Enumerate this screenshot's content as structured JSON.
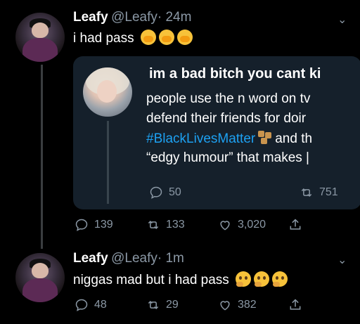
{
  "tweet1": {
    "name": "Leafy",
    "handle": "@Leafy",
    "time": "· 24m",
    "text": "i had pass",
    "emojis": [
      "face-with-hand-over-mouth",
      "face-with-hand-over-mouth",
      "face-with-hand-over-mouth"
    ],
    "stats": {
      "replies": "139",
      "retweets": "133",
      "likes": "3,020"
    }
  },
  "quoted": {
    "title": "im a bad bitch you cant ki",
    "line1": "people use the n word on tv",
    "line2": "defend their friends for doir",
    "hashtag": "#BlackLivesMatter",
    "line3_end": "and th",
    "line4": "“edgy humour” that makes |",
    "stats": {
      "replies": "50",
      "retweets": "751"
    }
  },
  "tweet2": {
    "name": "Leafy",
    "handle": "@Leafy",
    "time": "· 1m",
    "text": "niggas mad but i had pass",
    "emojis": [
      "thinking-face",
      "thinking-face",
      "thinking-face"
    ],
    "stats": {
      "replies": "48",
      "retweets": "29",
      "likes": "382"
    }
  },
  "colors": {
    "background": "#000000",
    "card": "#15202b",
    "muted": "#8b98a5",
    "link": "#1da1f2"
  }
}
